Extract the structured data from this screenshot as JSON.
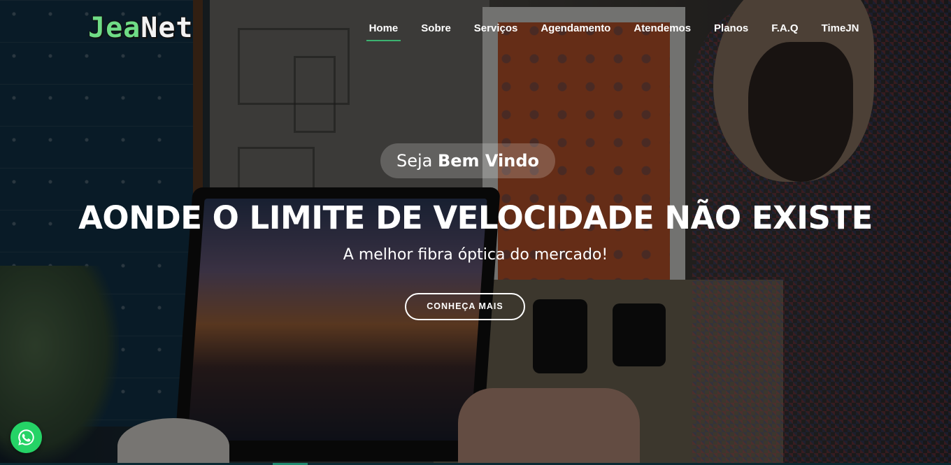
{
  "brand": {
    "logo_part_a": "Jea",
    "logo_part_b": "Net",
    "accent_color": "#6fdc86"
  },
  "nav": {
    "items": [
      {
        "label": "Home",
        "active": true
      },
      {
        "label": "Sobre",
        "active": false
      },
      {
        "label": "Serviços",
        "active": false
      },
      {
        "label": "Agendamento",
        "active": false
      },
      {
        "label": "Atendemos",
        "active": false
      },
      {
        "label": "Planos",
        "active": false
      },
      {
        "label": "F.A.Q",
        "active": false
      },
      {
        "label": "TimeJN",
        "active": false
      }
    ],
    "active_underline_color": "#3cb371"
  },
  "hero": {
    "welcome_prefix": "Seja",
    "welcome_bold": "Bem Vindo",
    "headline": "AONDE O LIMITE DE VELOCIDADE NÃO EXISTE",
    "subline": "A melhor fibra óptica do mercado!",
    "cta_label": "CONHEÇA MAIS"
  },
  "floating": {
    "whatsapp_icon": "whatsapp-icon",
    "whatsapp_color": "#25d366"
  }
}
